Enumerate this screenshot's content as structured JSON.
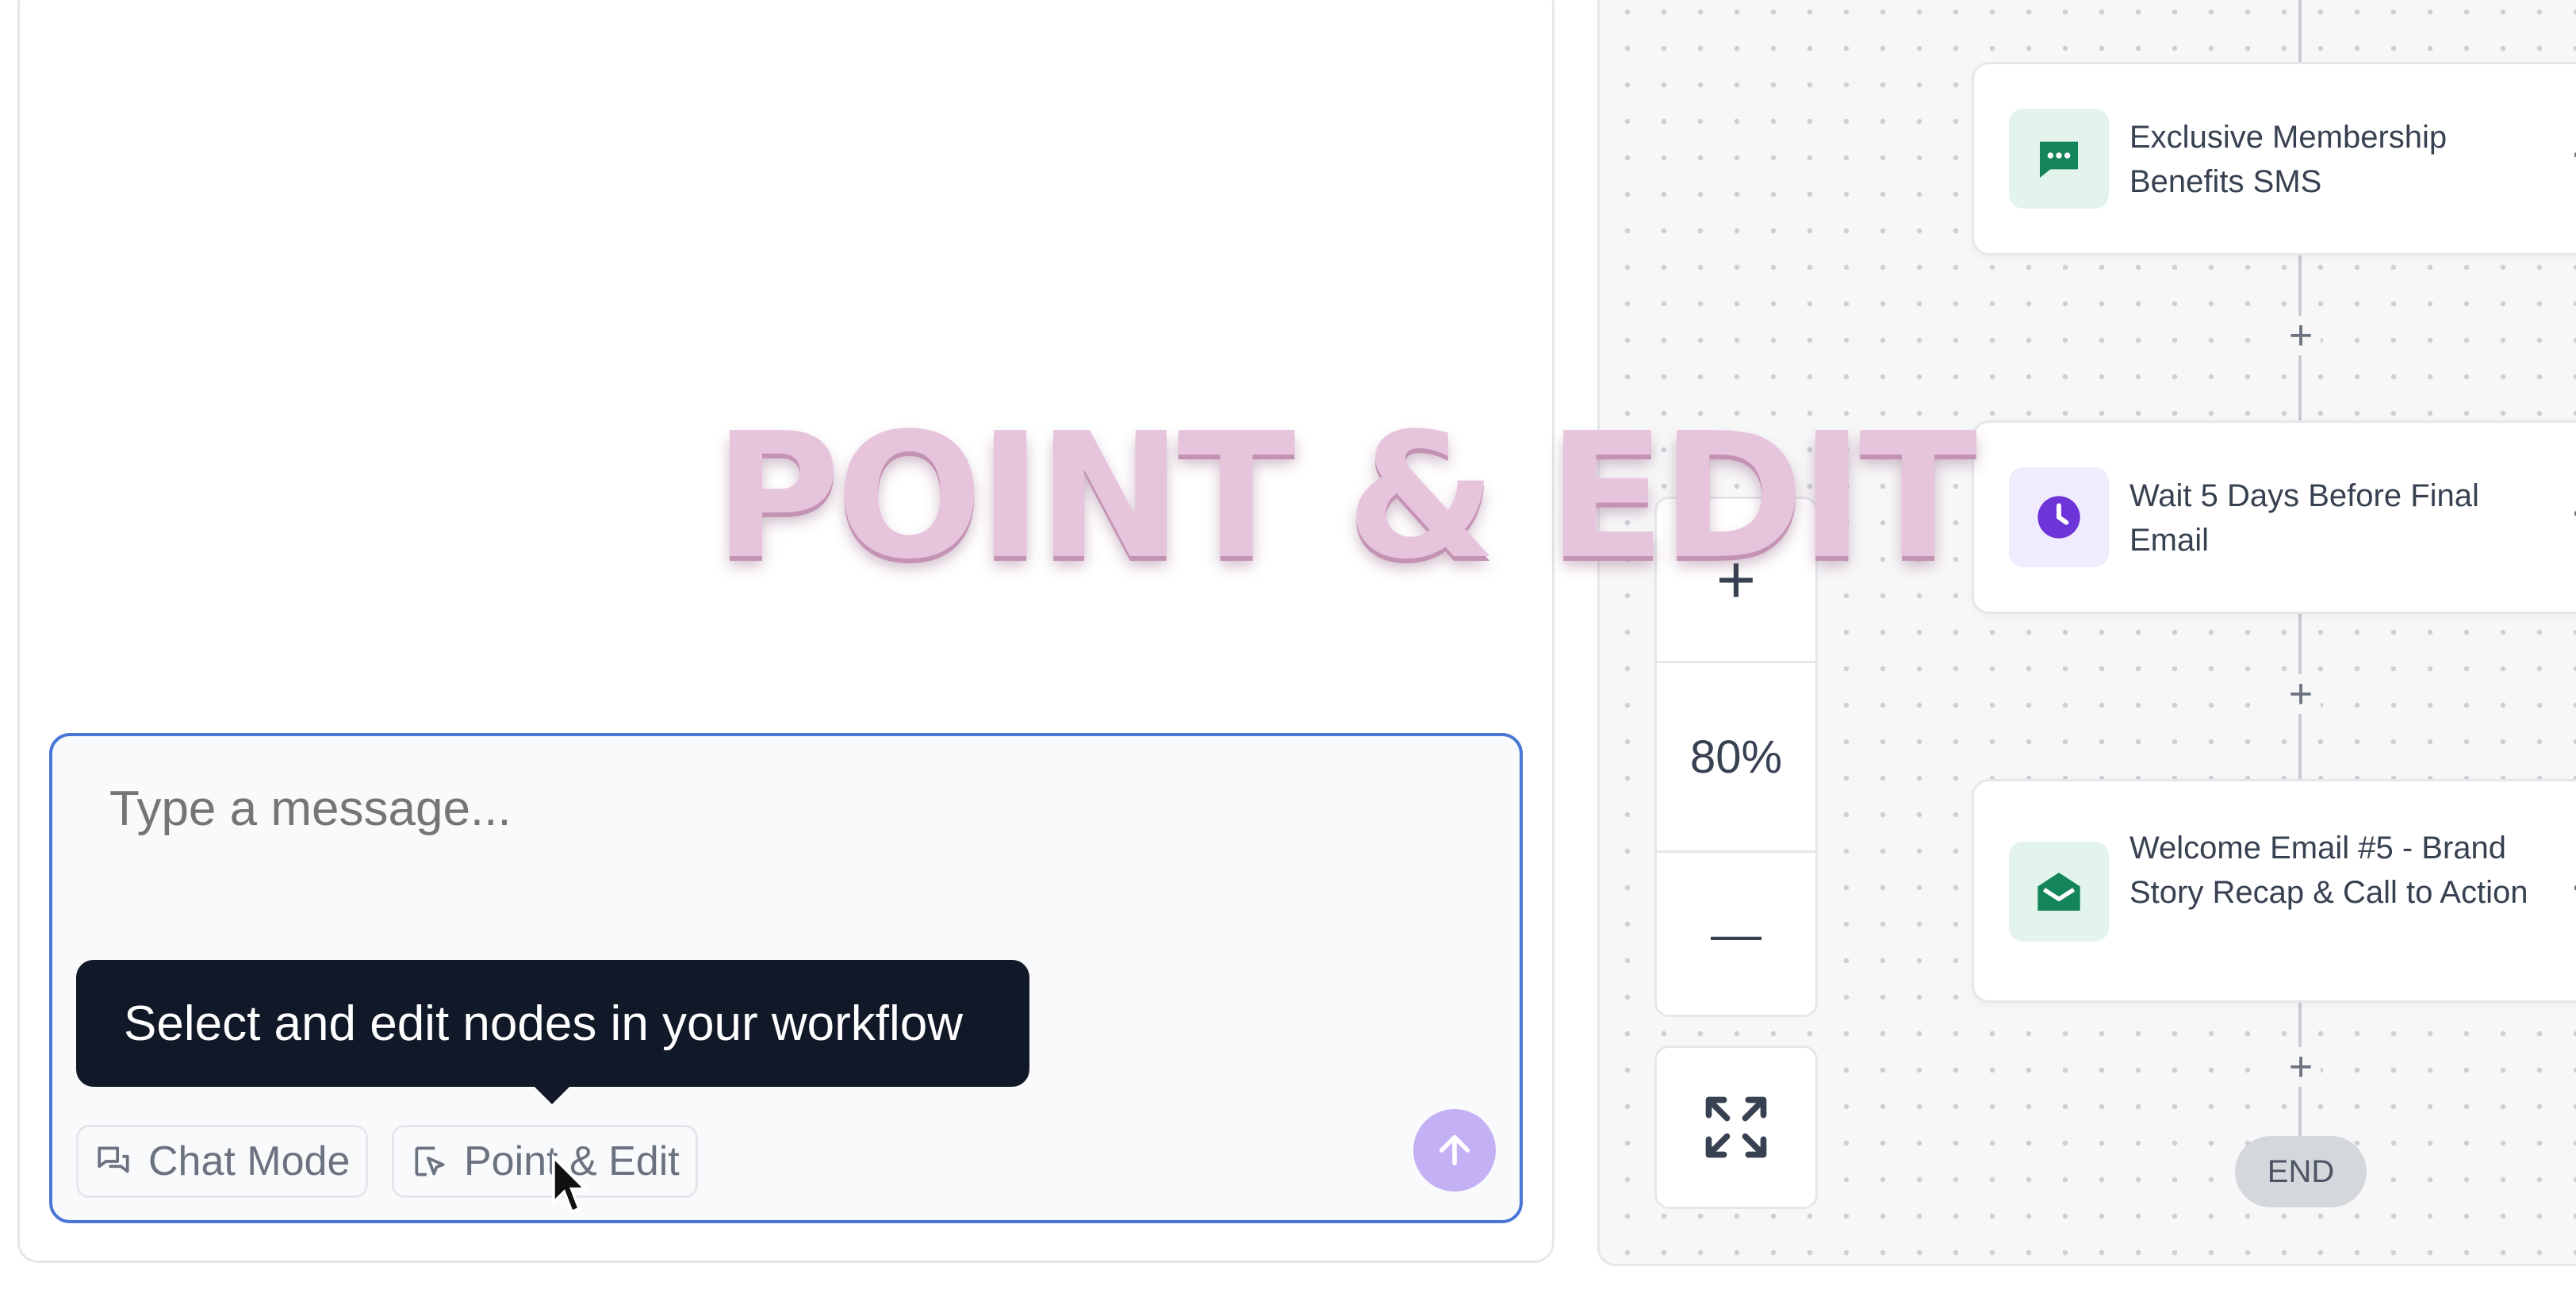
{
  "chat": {
    "placeholder": "Type a message...",
    "tooltip": "Select and edit nodes in your workflow",
    "chat_mode_label": "Chat Mode",
    "point_edit_label": "Point & Edit",
    "send_icon": "arrow-up-icon"
  },
  "overlay": {
    "title": "POINT & EDIT"
  },
  "workflow": {
    "nodes": [
      {
        "label": "Exclusive Membership Benefits SMS",
        "icon": "sms-icon"
      },
      {
        "label": "Wait 5 Days Before Final Email",
        "icon": "clock-icon"
      },
      {
        "label": "Welcome Email #5 - Brand Story Recap & Call to Action",
        "icon": "email-icon"
      }
    ],
    "add_step_symbol": "+",
    "end_label": "END",
    "menu_symbol": "⋯"
  },
  "zoom": {
    "level": "80%",
    "zoom_in_symbol": "+",
    "zoom_out_symbol": "—"
  },
  "colors": {
    "accent_border": "#4a77d6",
    "send_button": "#c4b0f5",
    "tooltip_bg": "#111827",
    "sms_icon_bg": "#e3f4ec",
    "sms_icon_fg": "#14855a",
    "clock_icon_bg": "#f0ebfd",
    "clock_icon_fg": "#6d34d8",
    "email_icon_bg": "#e3f4ec",
    "email_icon_fg": "#14855a"
  }
}
